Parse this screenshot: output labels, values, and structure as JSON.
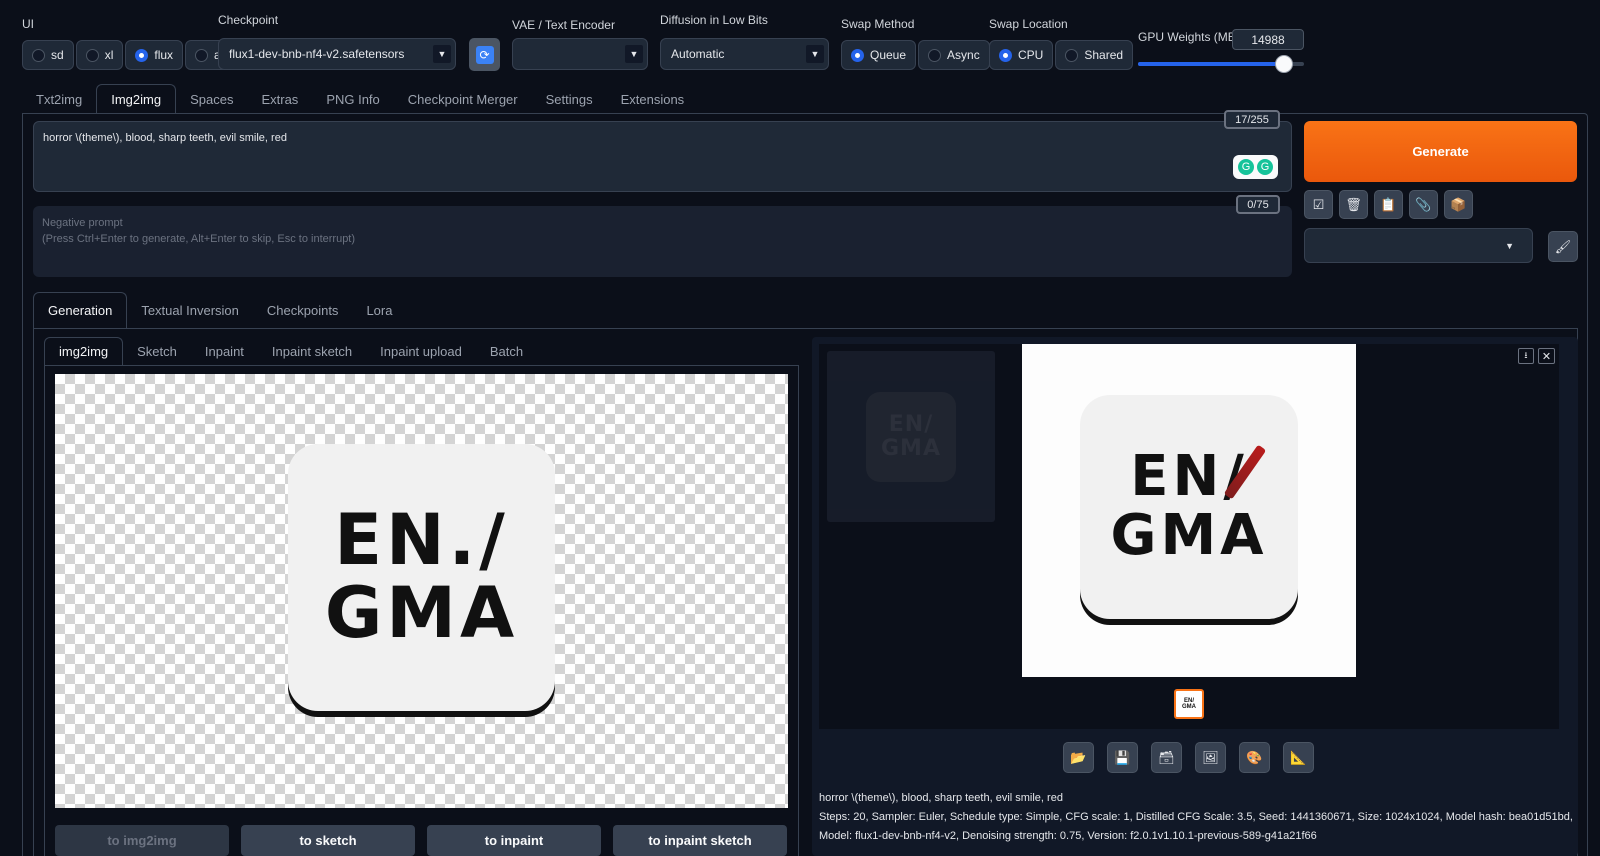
{
  "top": {
    "ui": {
      "label": "UI",
      "options": [
        "sd",
        "xl",
        "flux",
        "all"
      ],
      "selected": "flux"
    },
    "checkpoint": {
      "label": "Checkpoint",
      "value": "flux1-dev-bnb-nf4-v2.safetensors"
    },
    "vae": {
      "label": "VAE / Text Encoder",
      "value": ""
    },
    "diffusion": {
      "label": "Diffusion in Low Bits",
      "value": "Automatic"
    },
    "swap_method": {
      "label": "Swap Method",
      "options": [
        "Queue",
        "Async"
      ],
      "selected": "Queue"
    },
    "swap_location": {
      "label": "Swap Location",
      "options": [
        "CPU",
        "Shared"
      ],
      "selected": "CPU"
    },
    "gpu_weights": {
      "label": "GPU Weights (MB)",
      "value": "14988",
      "fraction": 0.88
    },
    "refresh_icon": "refresh-icon"
  },
  "main_tabs": [
    "Txt2img",
    "Img2img",
    "Spaces",
    "Extras",
    "PNG Info",
    "Checkpoint Merger",
    "Settings",
    "Extensions"
  ],
  "main_tab_active": "Img2img",
  "prompt": {
    "value": "horror \\(theme\\), blood,  sharp teeth,  evil smile, red",
    "token_count": "17/255"
  },
  "negative_prompt": {
    "placeholder_line1": "Negative prompt",
    "placeholder_line2": "(Press Ctrl+Enter to generate, Alt+Enter to skip, Esc to interrupt)",
    "token_count": "0/75"
  },
  "generate_label": "Generate",
  "tool_icons": [
    "check-icon",
    "trash-icon",
    "clipboard-icon",
    "paperclip-icon",
    "box-icon"
  ],
  "style_select_value": "",
  "sub_tabs": [
    "Generation",
    "Textual Inversion",
    "Checkpoints",
    "Lora"
  ],
  "sub_tab_active": "Generation",
  "img_tabs": [
    "img2img",
    "Sketch",
    "Inpaint",
    "Inpaint sketch",
    "Inpaint upload",
    "Batch"
  ],
  "img_tab_active": "img2img",
  "input_logo": {
    "line1": "EN./",
    "line2": "GMA"
  },
  "output_logo": {
    "line1": "EN/",
    "line2": "GMA"
  },
  "send_buttons": [
    "to img2img",
    "to sketch",
    "to inpaint",
    "to inpaint sketch"
  ],
  "output_icons": [
    "folder-icon",
    "save-icon",
    "archive-icon",
    "image-icon",
    "palette-icon",
    "ruler-icon"
  ],
  "output_info": {
    "prompt": "horror \\(theme\\), blood, sharp teeth, evil smile, red",
    "params_line1": "Steps: 20, Sampler: Euler, Schedule type: Simple, CFG scale: 1, Distilled CFG Scale: 3.5, Seed: 1441360671, Size: 1024x1024, Model hash: bea01d51bd,",
    "params_line2": "Model: flux1-dev-bnb-nf4-v2, Denoising strength: 0.75, Version: f2.0.1v1.10.1-previous-589-g41a21f66"
  },
  "colors": {
    "accent": "#2563eb",
    "generate": "#f97316",
    "bg": "#0b0f19"
  }
}
